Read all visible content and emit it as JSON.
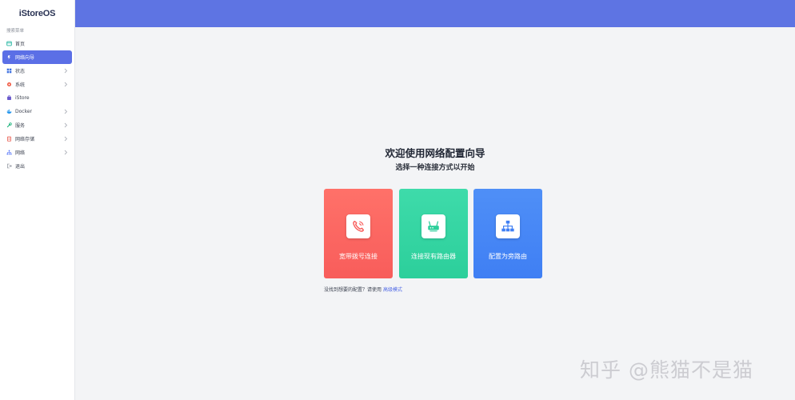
{
  "app": {
    "logo": "iStoreOS"
  },
  "sidebar": {
    "search_label": "搜索菜单",
    "items": [
      {
        "label": "首页",
        "icon": "home-icon",
        "color": "#22b5a0"
      },
      {
        "label": "网络向导",
        "icon": "wizard-icon",
        "color": "#ffffff",
        "active": true
      },
      {
        "label": "状态",
        "icon": "grid-icon",
        "color": "#3b6fe0"
      },
      {
        "label": "系统",
        "icon": "gear-icon",
        "color": "#f0563f"
      },
      {
        "label": "iStore",
        "icon": "store-icon",
        "color": "#6a5acd"
      },
      {
        "label": "Docker",
        "icon": "docker-icon",
        "color": "#2496ed"
      },
      {
        "label": "服务",
        "icon": "service-icon",
        "color": "#21b57f"
      },
      {
        "label": "网络存储",
        "icon": "storage-icon",
        "color": "#e8564a"
      },
      {
        "label": "网络",
        "icon": "network-icon",
        "color": "#4a6cf7"
      },
      {
        "label": "退出",
        "icon": "logout-icon",
        "color": "#8a8f99"
      }
    ]
  },
  "colors": {
    "topbar": "#5e74e3",
    "accent": "#5b6fe6",
    "card_red": "#f85d5b",
    "card_green": "#2ccf9b",
    "card_blue": "#3f7ff4"
  },
  "wizard": {
    "title": "欢迎使用网络配置向导",
    "subtitle": "选择一种连接方式以开始",
    "cards": [
      {
        "label": "宽带拨号连接",
        "icon": "phone-icon"
      },
      {
        "label": "连接现有路由器",
        "icon": "router-icon"
      },
      {
        "label": "配置为旁路由",
        "icon": "topology-icon"
      }
    ],
    "hint_text": "没找到想要的配置？请使用",
    "hint_link": "高级模式"
  },
  "watermark": "知乎 @熊猫不是猫"
}
